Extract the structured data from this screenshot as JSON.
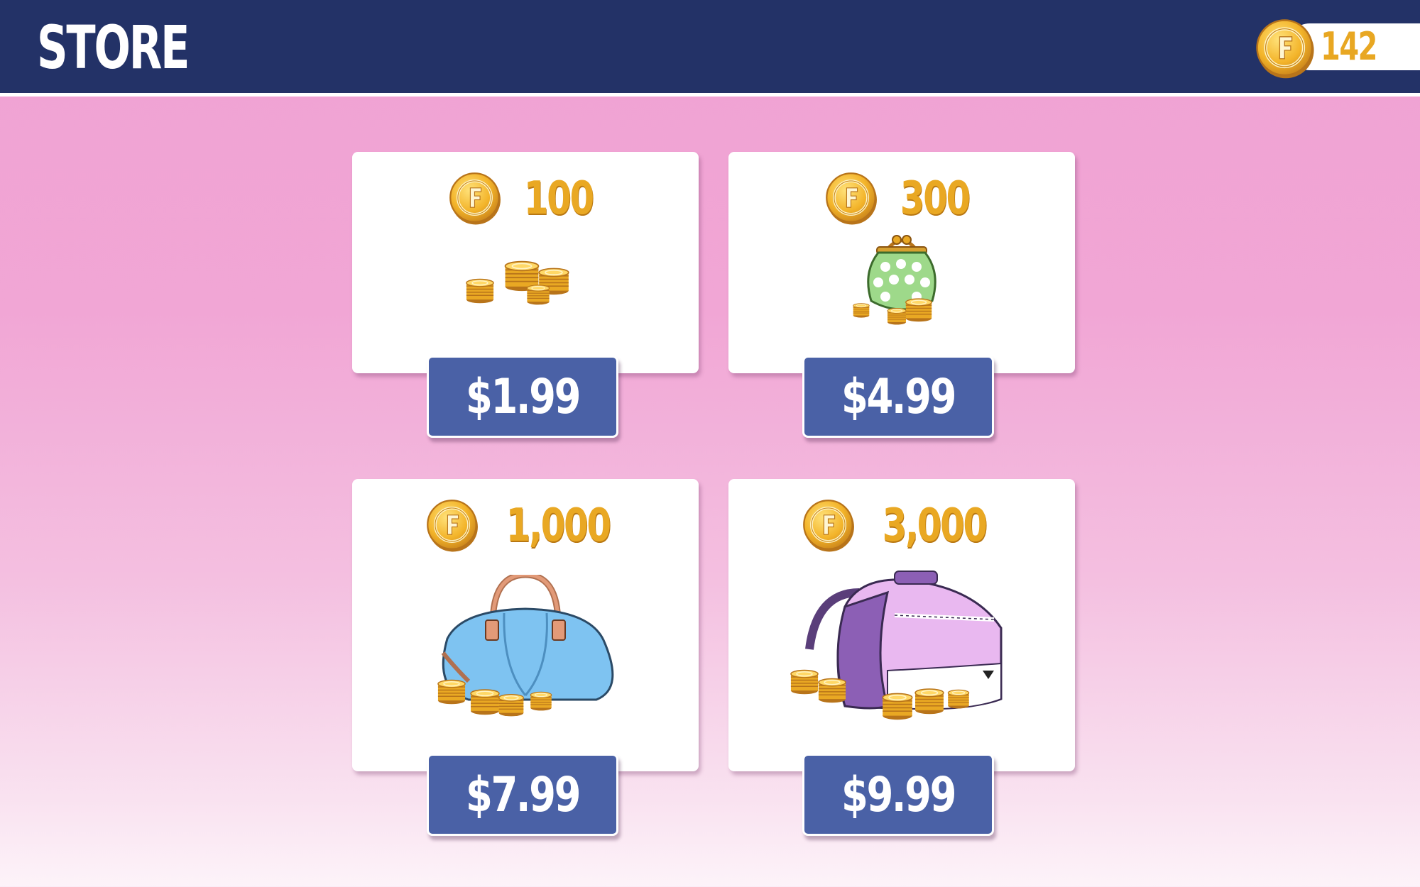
{
  "header": {
    "title": "STORE",
    "balance": "142",
    "balance_icon": "f-coin-icon"
  },
  "packs": [
    {
      "coins": "100",
      "price": "$1.99",
      "illustration": "coin-stacks-icon"
    },
    {
      "coins": "300",
      "price": "$4.99",
      "illustration": "polka-dot-coin-purse-icon"
    },
    {
      "coins": "1,000",
      "price": "$7.99",
      "illustration": "blue-handbag-icon"
    },
    {
      "coins": "3,000",
      "price": "$9.99",
      "illustration": "purple-duffel-bag-icon"
    }
  ],
  "colors": {
    "header_bg": "#233267",
    "coin_gold": "#e9a823",
    "button_bg": "#4a61a6",
    "background_top": "#f0a2d3",
    "background_bottom": "#fdf3f9"
  }
}
